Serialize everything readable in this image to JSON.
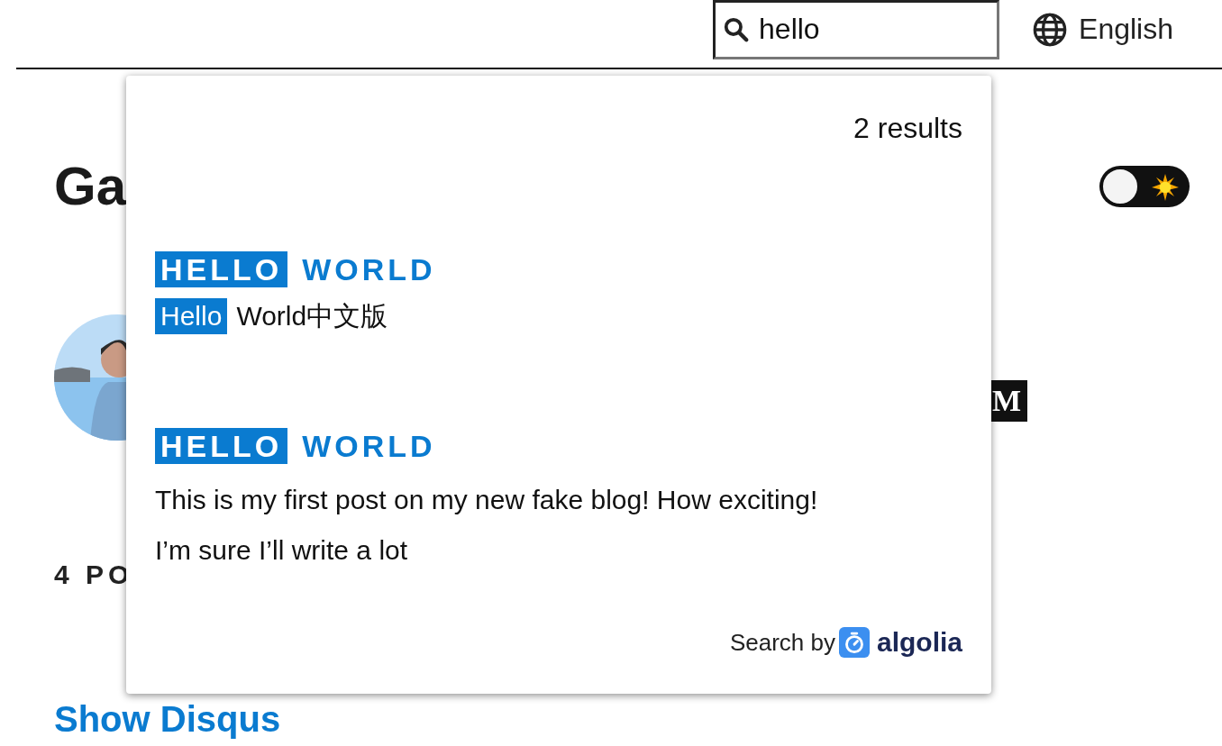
{
  "header": {
    "search": {
      "value": "hello"
    },
    "language": "English"
  },
  "page": {
    "title": "Ga",
    "theme_toggle": {
      "on": false
    },
    "social_icon": "M",
    "posts_heading": "4 PO",
    "comments_link": "Show Disqus"
  },
  "search_results": {
    "count": "2 results",
    "hits": [
      {
        "title": [
          {
            "text": "HELLO",
            "highlighted": true
          },
          {
            "text": "WORLD",
            "highlighted": false
          }
        ],
        "snippet": [
          {
            "text": "Hello",
            "highlighted": true
          },
          {
            "text": "World中文版",
            "highlighted": false
          }
        ]
      },
      {
        "title": [
          {
            "text": "HELLO",
            "highlighted": true
          },
          {
            "text": "WORLD",
            "highlighted": false
          }
        ],
        "snippet": [
          {
            "text": "This is my first post on my new fake blog! How exciting! I’m sure I’ll write a lot",
            "highlighted": false
          }
        ]
      }
    ],
    "footer": {
      "label": "Search by",
      "brand": "algolia"
    }
  }
}
